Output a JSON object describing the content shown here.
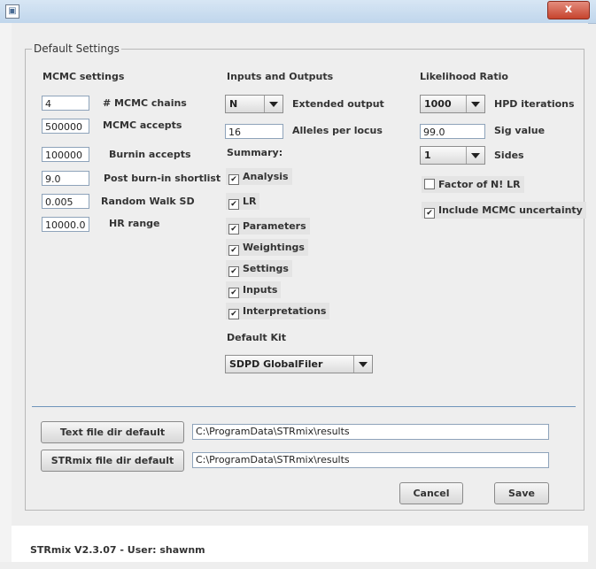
{
  "window": {
    "app_icon": "app-icon",
    "close_label": "x"
  },
  "group_title": "Default Settings",
  "mcmc": {
    "header": "MCMC settings",
    "chains": {
      "value": "4",
      "label": "# MCMC chains"
    },
    "accepts": {
      "value": "500000",
      "label": "MCMC accepts"
    },
    "burnin": {
      "value": "100000",
      "label": "Burnin accepts"
    },
    "shortlist": {
      "value": "9.0",
      "label": "Post burn-in shortlist"
    },
    "random_walk": {
      "value": "0.005",
      "label": "Random Walk SD"
    },
    "hr_range": {
      "value": "10000.0",
      "label": "HR range"
    }
  },
  "io": {
    "header": "Inputs and Outputs",
    "extended_output": {
      "value": "N",
      "label": "Extended output"
    },
    "alleles": {
      "value": "16",
      "label": "Alleles per locus"
    },
    "summary_label": "Summary:",
    "summary_items": [
      {
        "label": "Analysis",
        "checked": true
      },
      {
        "label": "LR",
        "checked": true
      },
      {
        "label": "Parameters",
        "checked": true
      },
      {
        "label": "Weightings",
        "checked": true
      },
      {
        "label": "Settings",
        "checked": true
      },
      {
        "label": "Inputs",
        "checked": true
      },
      {
        "label": "Interpretations",
        "checked": true
      }
    ],
    "default_kit_label": "Default Kit",
    "default_kit_value": "SDPD GlobalFiler"
  },
  "lr": {
    "header": "Likelihood Ratio",
    "hpd": {
      "value": "1000",
      "label": "HPD iterations"
    },
    "sig": {
      "value": "99.0",
      "label": "Sig value"
    },
    "sides": {
      "value": "1",
      "label": "Sides"
    },
    "factor": {
      "label": "Factor of N! LR",
      "checked": false
    },
    "include_mcmc": {
      "label": "Include MCMC uncertainty",
      "checked": true
    }
  },
  "dirs": {
    "text_button": "Text file dir default",
    "text_path": "C:\\ProgramData\\STRmix\\results",
    "strmix_button": "STRmix file dir default",
    "strmix_path": "C:\\ProgramData\\STRmix\\results"
  },
  "actions": {
    "cancel": "Cancel",
    "save": "Save"
  },
  "status": "STRmix V2.3.07 - User: shawnm",
  "colors": {
    "separator": "#6f94bb",
    "titlebar": "#c8dbee",
    "close": "#c6442e"
  }
}
